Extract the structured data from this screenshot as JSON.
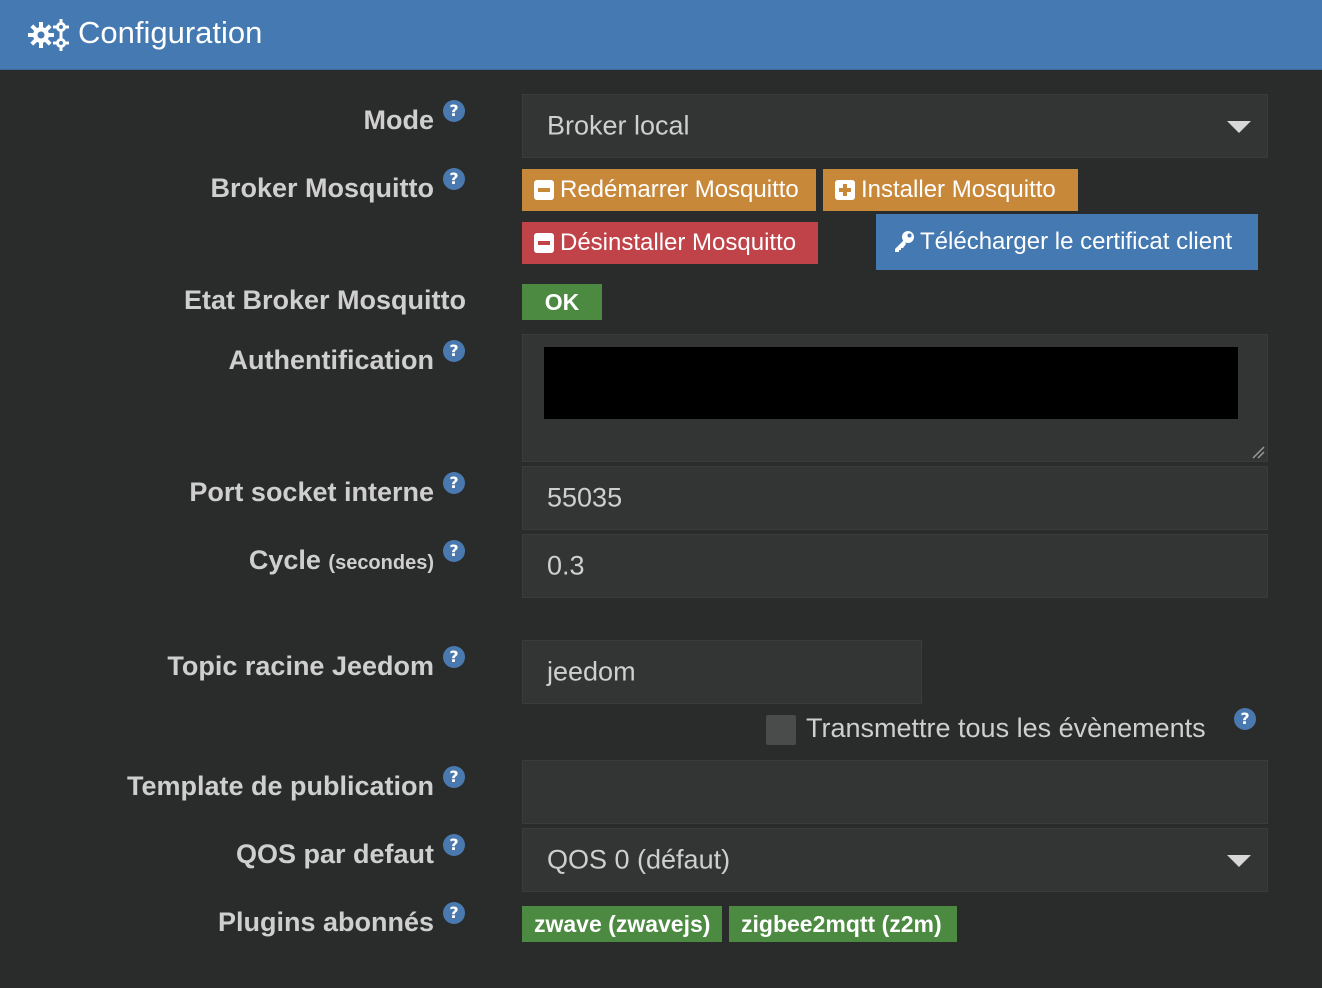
{
  "header": {
    "title": "Configuration",
    "icon": "gears-icon"
  },
  "colors": {
    "header_bg": "#4479b1",
    "page_bg": "#2a2b2b",
    "field_bg": "#333434",
    "warning": "#c8883a",
    "danger": "#c0434a",
    "primary": "#4479b1",
    "success": "#4c8a42"
  },
  "form": {
    "mode": {
      "label": "Mode",
      "value": "Broker local"
    },
    "broker": {
      "label": "Broker Mosquitto",
      "restart_label": "Redémarrer Mosquitto",
      "install_label": "Installer Mosquitto",
      "uninstall_label": "Désinstaller Mosquitto",
      "download_label": "Télécharger le certificat client"
    },
    "broker_state": {
      "label": "Etat Broker Mosquitto",
      "value": "OK"
    },
    "auth": {
      "label": "Authentification"
    },
    "port": {
      "label": "Port socket interne",
      "value": "55035"
    },
    "cycle": {
      "label": "Cycle",
      "unit": "(secondes)",
      "value": "0.3"
    },
    "topic": {
      "label": "Topic racine Jeedom",
      "value": "jeedom"
    },
    "transmit": {
      "label": "Transmettre tous les évènements",
      "checked": false
    },
    "template": {
      "label": "Template de publication",
      "value": ""
    },
    "qos": {
      "label": "QOS par defaut",
      "value": "QOS 0 (défaut)"
    },
    "plugins": {
      "label": "Plugins abonnés",
      "items": [
        "zwave (zwavejs)",
        "zigbee2mqtt (z2m)"
      ]
    }
  }
}
